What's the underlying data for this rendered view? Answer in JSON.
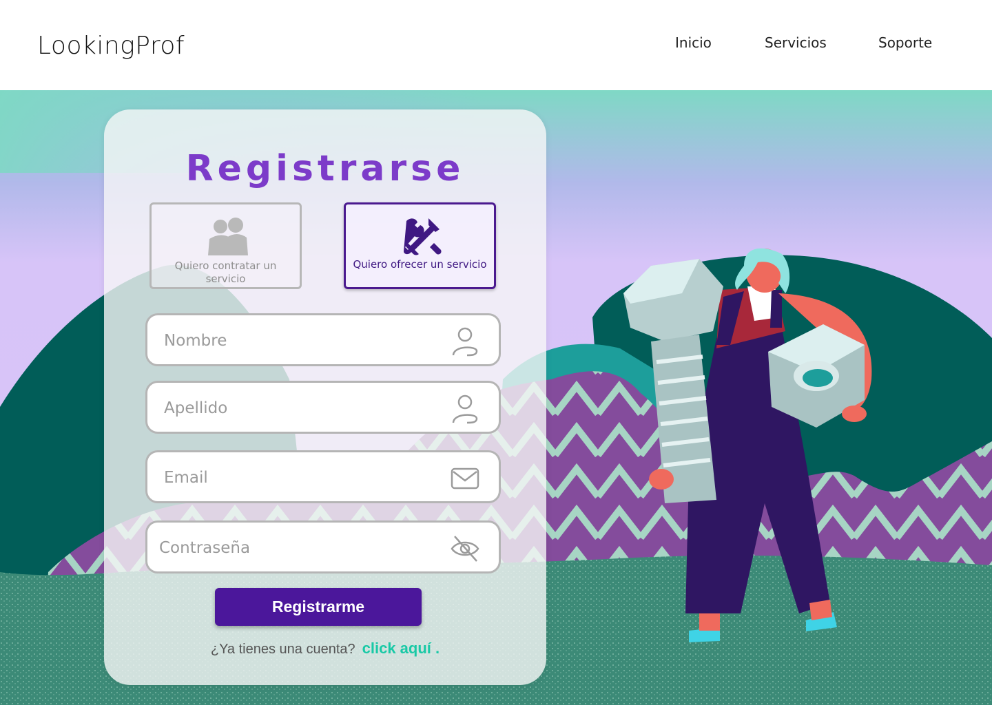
{
  "header": {
    "logo": "LookingProf",
    "nav": [
      {
        "label": "Inicio"
      },
      {
        "label": "Servicios"
      },
      {
        "label": "Soporte"
      }
    ]
  },
  "form": {
    "title": "Registrarse",
    "roles": {
      "hire": {
        "label": "Quiero contratar un servicio",
        "icon": "users-icon",
        "selected": false
      },
      "offer": {
        "label": "Quiero ofrecer un servicio",
        "icon": "tools-icon",
        "selected": true
      }
    },
    "fields": {
      "nombre": {
        "placeholder": "Nombre",
        "icon": "user-icon"
      },
      "apellido": {
        "placeholder": "Apellido",
        "icon": "user-icon"
      },
      "email": {
        "placeholder": "Email",
        "icon": "envelope-icon"
      },
      "password": {
        "placeholder": "Contraseña",
        "icon": "eye-off-icon"
      }
    },
    "submit_label": "Registrarme",
    "login_prompt": "¿Ya tienes una cuenta?",
    "login_link": "click aquí ."
  },
  "colors": {
    "accent": "#7c3bc9",
    "button": "#4b179b",
    "link": "#19c9a6",
    "hill_dark": "#005f5a",
    "ground": "#3d8a78"
  }
}
